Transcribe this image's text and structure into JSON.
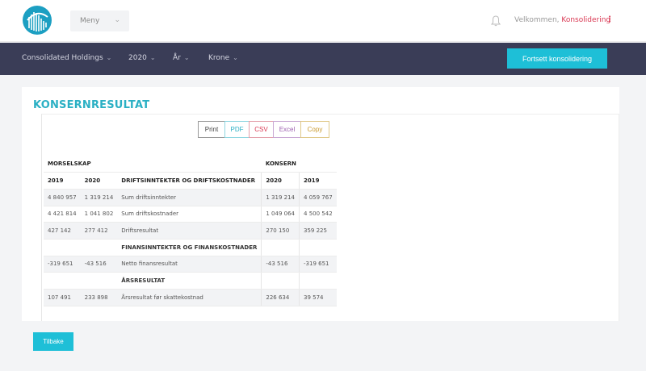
{
  "header": {
    "menu_label": "Meny",
    "welcome_prefix": "Velkommen, ",
    "welcome_user": "Konsolidering",
    "kebab": "⋮"
  },
  "nav": {
    "company": "Consolidated Holdings",
    "year": "2020",
    "period": "År",
    "currency": "Krone",
    "continue_button": "Fortsett konsolidering"
  },
  "main": {
    "title": "KONSERNRESULTAT",
    "export_buttons": [
      "Print",
      "PDF",
      "CSV",
      "Excel",
      "Copy"
    ],
    "back_button": "Tilbake"
  },
  "report": {
    "group_left": "MORSELSKAP",
    "group_right": "KONSERN",
    "col_2019": "2019",
    "col_2020": "2020",
    "col_k2020": "2020",
    "col_k2019": "2019",
    "rows": [
      {
        "a": "",
        "b": "",
        "label": "DRIFTSINNTEKTER OG DRIFTSKOSTNADER",
        "c": "",
        "d": "",
        "kind": "subhead"
      },
      {
        "a": "4 840 957",
        "b": "1 319 214",
        "label": "Sum driftsinntekter",
        "c": "1 319 214",
        "d": "4 059 767",
        "kind": "shade"
      },
      {
        "a": "4 421 814",
        "b": "1 041 802",
        "label": "Sum driftskostnader",
        "c": "1 049 064",
        "d": "4 500 542",
        "kind": "plain"
      },
      {
        "a": "427 142",
        "b": "277 412",
        "label": "Driftsresultat",
        "c": "270 150",
        "d": "359 225",
        "kind": "shade"
      },
      {
        "a": "",
        "b": "",
        "label": "FINANSINNTEKTER OG FINANSKOSTNADER",
        "c": "",
        "d": "",
        "kind": "subhead"
      },
      {
        "a": "-319 651",
        "b": "-43 516",
        "label": "Netto finansresultat",
        "c": "-43 516",
        "d": "-319 651",
        "kind": "shade"
      },
      {
        "a": "",
        "b": "",
        "label": "ÅRSRESULTAT",
        "c": "",
        "d": "",
        "kind": "subhead"
      },
      {
        "a": "107 491",
        "b": "233 898",
        "label": "Årsresultat før skattekostnad",
        "c": "226 634",
        "d": "39 574",
        "kind": "shade"
      }
    ]
  },
  "colors": {
    "accent": "#1ebfd7",
    "title": "#2bb0c4",
    "navbar": "#3a3d57",
    "user": "#d93651"
  }
}
